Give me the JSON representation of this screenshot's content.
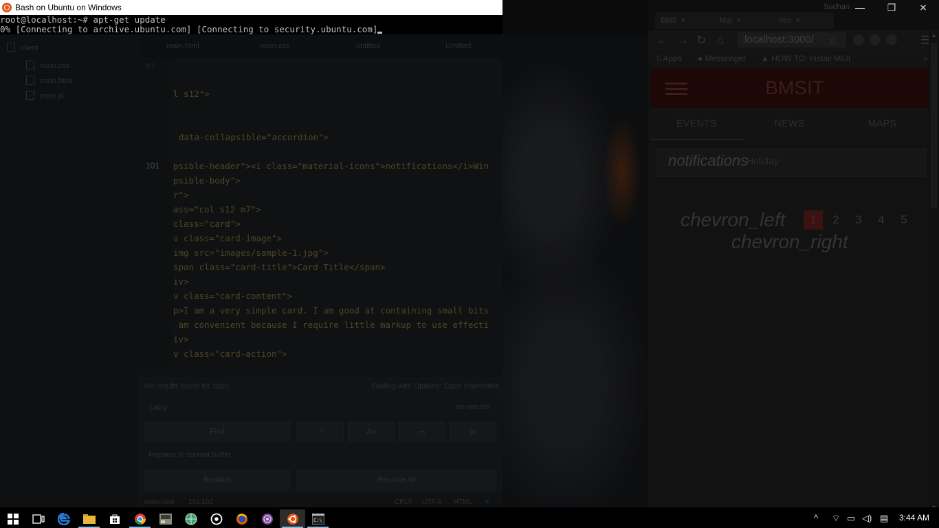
{
  "bash": {
    "title": "Bash on Ubuntu on Windows",
    "line1": "root@localhost:~# apt-get update",
    "line2": "0% [Connecting to archive.ubuntu.com] [Connecting to security.ubuntu.com]"
  },
  "window_controls": {
    "user": "Sudhan",
    "minimize": "—",
    "restore": "❐",
    "close": "✕"
  },
  "editor": {
    "tree": {
      "folder": "client",
      "files": [
        "main.css",
        "main.html",
        "main.js"
      ]
    },
    "tabs": [
      "main.html",
      "main.css",
      "untitled",
      "Untitled"
    ],
    "gutter": {
      "line_before": "97",
      "current_line": "101"
    },
    "code_lines": [
      "l s12\">",
      "data-collapsible=\"accordion\">",
      "psible-header\"><i class=\"material-icons\">notifications</i>Win",
      "psible-body\">",
      "r\">",
      "ass=\"col s12 m7\">",
      "class=\"card\">",
      "v class=\"card-image\">",
      "img src=\"images/sample-1.jpg\">",
      "span class=\"card-title\">Card Title</span>",
      "iv>",
      "v class=\"card-content\">",
      "p>I am a very simple card. I am good at containing small bits",
      " am convenient because I require little markup to use effecti",
      "iv>",
      "v class=\"card-action\">"
    ],
    "find": {
      "status": "No results found for 'tabu'",
      "scope": "Finding with Options: Case Insensitive",
      "query": "tabu",
      "count": "no results",
      "find_button": "Find",
      "regex_button": ".*",
      "case_button": "Aa",
      "replace_label": "Replace in current buffer",
      "replace_button": "Replace",
      "replace_all_button": "Replace All"
    },
    "status": {
      "file": "main.html",
      "cursor": "101:102",
      "line_ending": "CRLF",
      "encoding": "UTF-8",
      "grammar": "HTML"
    }
  },
  "browser": {
    "tabs": [
      {
        "label": "BMS",
        "close": "×"
      },
      {
        "label": "Mat",
        "close": "×"
      },
      {
        "label": "htm",
        "close": "×"
      }
    ],
    "url": "localhost:3000/",
    "bookmarks": [
      "Apps",
      "Messenger",
      "HOW TO: Install MiUI"
    ],
    "app": {
      "title": "BMSIT",
      "tabs": [
        "EVENTS",
        "NEWS",
        "MAPS"
      ],
      "collapsible_icon_text": "notifications",
      "collapsible_label": "Holiday",
      "pagination": {
        "prev": "chevron_left",
        "next": "chevron_right",
        "pages": [
          "1",
          "2",
          "3",
          "4",
          "5"
        ],
        "active": "1"
      }
    }
  },
  "taskbar": {
    "icons": [
      "windows-start-icon",
      "task-view-icon",
      "edge-icon",
      "file-explorer-icon",
      "store-icon",
      "chrome-icon",
      "app-icon",
      "globe-app-icon",
      "media-icon",
      "firefox-icon",
      "tor-icon",
      "ubuntu-bash-icon",
      "cmd-icon"
    ],
    "clock": "3:44 AM"
  },
  "colors": {
    "ubuntu_orange": "#e05414",
    "app_accent": "#c62828",
    "taskbar_highlight": "#8ab8e0"
  }
}
